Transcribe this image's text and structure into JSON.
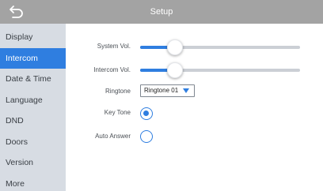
{
  "header": {
    "title": "Setup",
    "back_icon": "back-arrow-icon",
    "background_color": "#a3a3a3"
  },
  "sidebar": {
    "active_index": 1,
    "active_color": "#2f7ee0",
    "items": [
      {
        "label": "Display"
      },
      {
        "label": "Intercom"
      },
      {
        "label": "Date & Time"
      },
      {
        "label": "Language"
      },
      {
        "label": "DND"
      },
      {
        "label": "Doors"
      },
      {
        "label": "Version"
      },
      {
        "label": "More"
      }
    ]
  },
  "settings": {
    "system_vol": {
      "label": "System Vol.",
      "level": 0.22
    },
    "intercom_vol": {
      "label": "Intercom Vol.",
      "level": 0.22
    },
    "ringtone": {
      "label": "Ringtone",
      "value": "Ringtone 01"
    },
    "key_tone": {
      "label": "Key Tone",
      "checked": true
    },
    "auto_answer": {
      "label": "Auto Answer",
      "checked": false
    }
  }
}
